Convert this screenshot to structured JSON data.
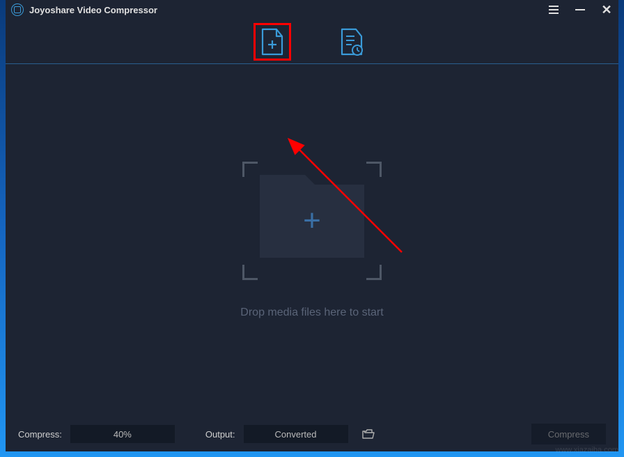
{
  "app": {
    "title": "Joyoshare Video Compressor"
  },
  "tabs": {
    "add_file_icon": "add-file",
    "history_icon": "history"
  },
  "dropzone": {
    "hint": "Drop media files here to start",
    "plus": "+"
  },
  "bottom": {
    "compress_label": "Compress:",
    "compress_value": "40%",
    "output_label": "Output:",
    "output_value": "Converted",
    "compress_button": "Compress"
  },
  "watermark": "www.xiazaiba.com",
  "colors": {
    "accent": "#3a9bd9",
    "panel": "#1d2433",
    "highlight": "#ff0000"
  }
}
